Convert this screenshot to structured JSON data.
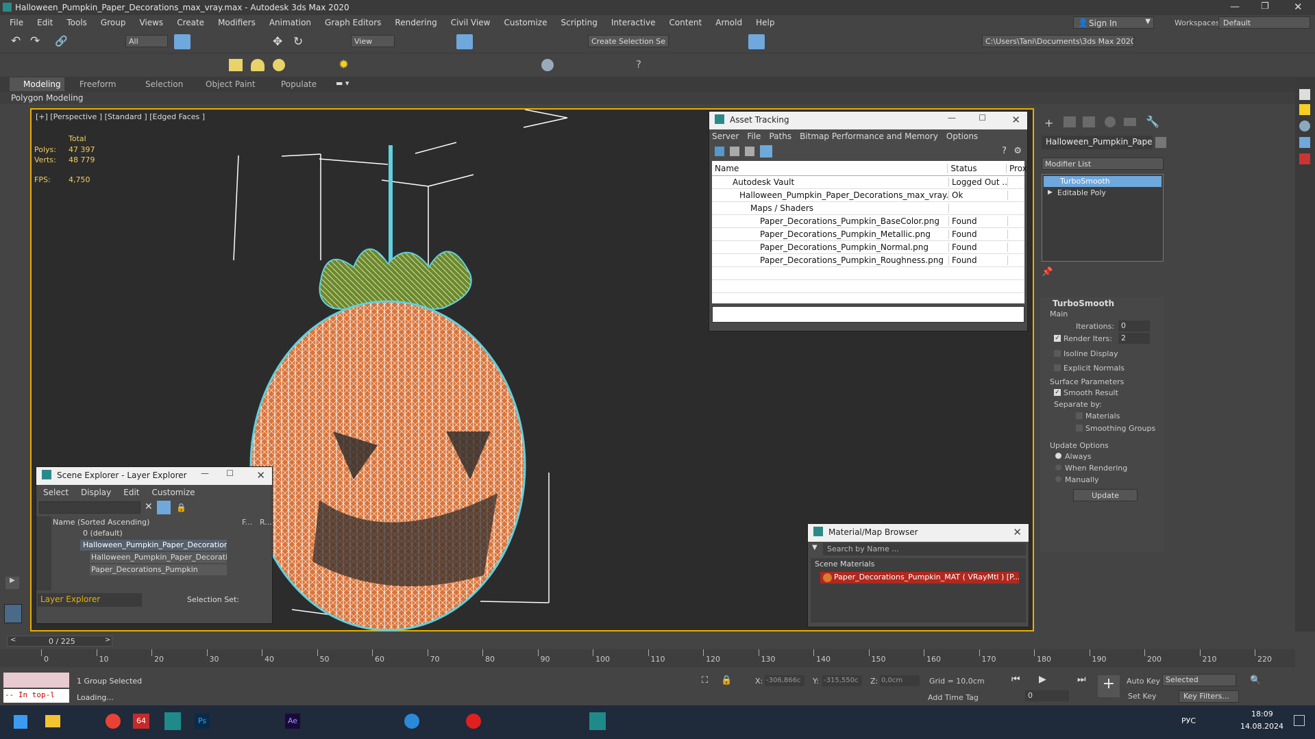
{
  "window": {
    "title": "Halloween_Pumpkin_Paper_Decorations_max_vray.max - Autodesk 3ds Max 2020"
  },
  "menu": [
    "File",
    "Edit",
    "Tools",
    "Group",
    "Views",
    "Create",
    "Modifiers",
    "Animation",
    "Graph Editors",
    "Rendering",
    "Civil View",
    "Customize",
    "Scripting",
    "Interactive",
    "Content",
    "Arnold",
    "Help"
  ],
  "account": {
    "sign_in": "Sign In",
    "workspaces_label": "Workspaces:",
    "workspace": "Default"
  },
  "toolbar": {
    "filter": "All",
    "view": "View",
    "selection_set": "Create Selection Se",
    "path": "C:\\Users\\Tani\\Documents\\3ds Max 2020"
  },
  "ribbon": {
    "tabs": [
      "Modeling",
      "Freeform",
      "Selection",
      "Object Paint",
      "Populate"
    ],
    "sub": "Polygon Modeling"
  },
  "viewport": {
    "label": "[+] [Perspective ] [Standard ] [Edged Faces ]",
    "stats": {
      "total": "Total",
      "polys_label": "Polys:",
      "polys": "47 397",
      "verts_label": "Verts:",
      "verts": "48 779",
      "fps_label": "FPS:",
      "fps": "4,750"
    }
  },
  "asset_tracking": {
    "title": "Asset Tracking",
    "menu": [
      "Server",
      "File",
      "Paths",
      "Bitmap Performance and Memory",
      "Options"
    ],
    "columns": [
      "Name",
      "Status",
      "Prox"
    ],
    "rows": [
      {
        "name": "Autodesk Vault",
        "status": "Logged Out ..."
      },
      {
        "name": "Halloween_Pumpkin_Paper_Decorations_max_vray....",
        "status": "Ok"
      },
      {
        "name": "Maps / Shaders",
        "status": ""
      },
      {
        "name": "Paper_Decorations_Pumpkin_BaseColor.png",
        "status": "Found"
      },
      {
        "name": "Paper_Decorations_Pumpkin_Metallic.png",
        "status": "Found"
      },
      {
        "name": "Paper_Decorations_Pumpkin_Normal.png",
        "status": "Found"
      },
      {
        "name": "Paper_Decorations_Pumpkin_Roughness.png",
        "status": "Found"
      }
    ]
  },
  "scene_explorer": {
    "title": "Scene Explorer - Layer Explorer",
    "menu": [
      "Select",
      "Display",
      "Edit",
      "Customize"
    ],
    "col_name": "Name (Sorted Ascending)",
    "col_f": "F...",
    "col_r": "R...",
    "items": [
      "0 (default)",
      "Halloween_Pumpkin_Paper_Decorations",
      "Halloween_Pumpkin_Paper_Decorations",
      "Paper_Decorations_Pumpkin"
    ],
    "footer_explorer": "Layer Explorer",
    "footer_selset": "Selection Set:"
  },
  "material_browser": {
    "title": "Material/Map Browser",
    "search_placeholder": "Search by Name ...",
    "group": "Scene Materials",
    "item": "Paper_Decorations_Pumpkin_MAT ( VRayMtl ) [P..."
  },
  "command_panel": {
    "object_name": "Halloween_Pumpkin_Paper",
    "modifier_list": "Modifier List",
    "stack": [
      "TurboSmooth",
      "Editable Poly"
    ],
    "rollout": "TurboSmooth",
    "main": "Main",
    "iterations_label": "Iterations:",
    "iterations": "0",
    "render_iters_label": "Render Iters:",
    "render_iters": "2",
    "isoline": "Isoline Display",
    "explicit_normals": "Explicit Normals",
    "surface_params": "Surface Parameters",
    "smooth_result": "Smooth Result",
    "separate_by": "Separate by:",
    "materials": "Materials",
    "smoothing_groups": "Smoothing Groups",
    "update_options": "Update Options",
    "always": "Always",
    "when_rendering": "When Rendering",
    "manually": "Manually",
    "update_btn": "Update"
  },
  "timeline": {
    "frame": "0 / 225",
    "ticks": [
      "0",
      "10",
      "20",
      "30",
      "40",
      "50",
      "60",
      "70",
      "80",
      "90",
      "100",
      "110",
      "120",
      "130",
      "140",
      "150",
      "160",
      "170",
      "180",
      "190",
      "200",
      "210",
      "220"
    ]
  },
  "status": {
    "maxscript": "-- In top-l",
    "selected": "1 Group Selected",
    "loading": "Loading...",
    "x_label": "X:",
    "x": "-306,866c",
    "y_label": "Y:",
    "y": "-315,550c",
    "z_label": "Z:",
    "z": "0,0cm",
    "grid": "Grid = 10,0cm",
    "add_time_tag": "Add Time Tag",
    "auto_key": "Auto Key",
    "set_key": "Set Key",
    "key_select": "Selected",
    "key_filters": "Key Filters...",
    "frame_field": "0"
  },
  "taskbar": {
    "lang": "РУС",
    "time": "18:09",
    "date": "14.08.2024"
  }
}
